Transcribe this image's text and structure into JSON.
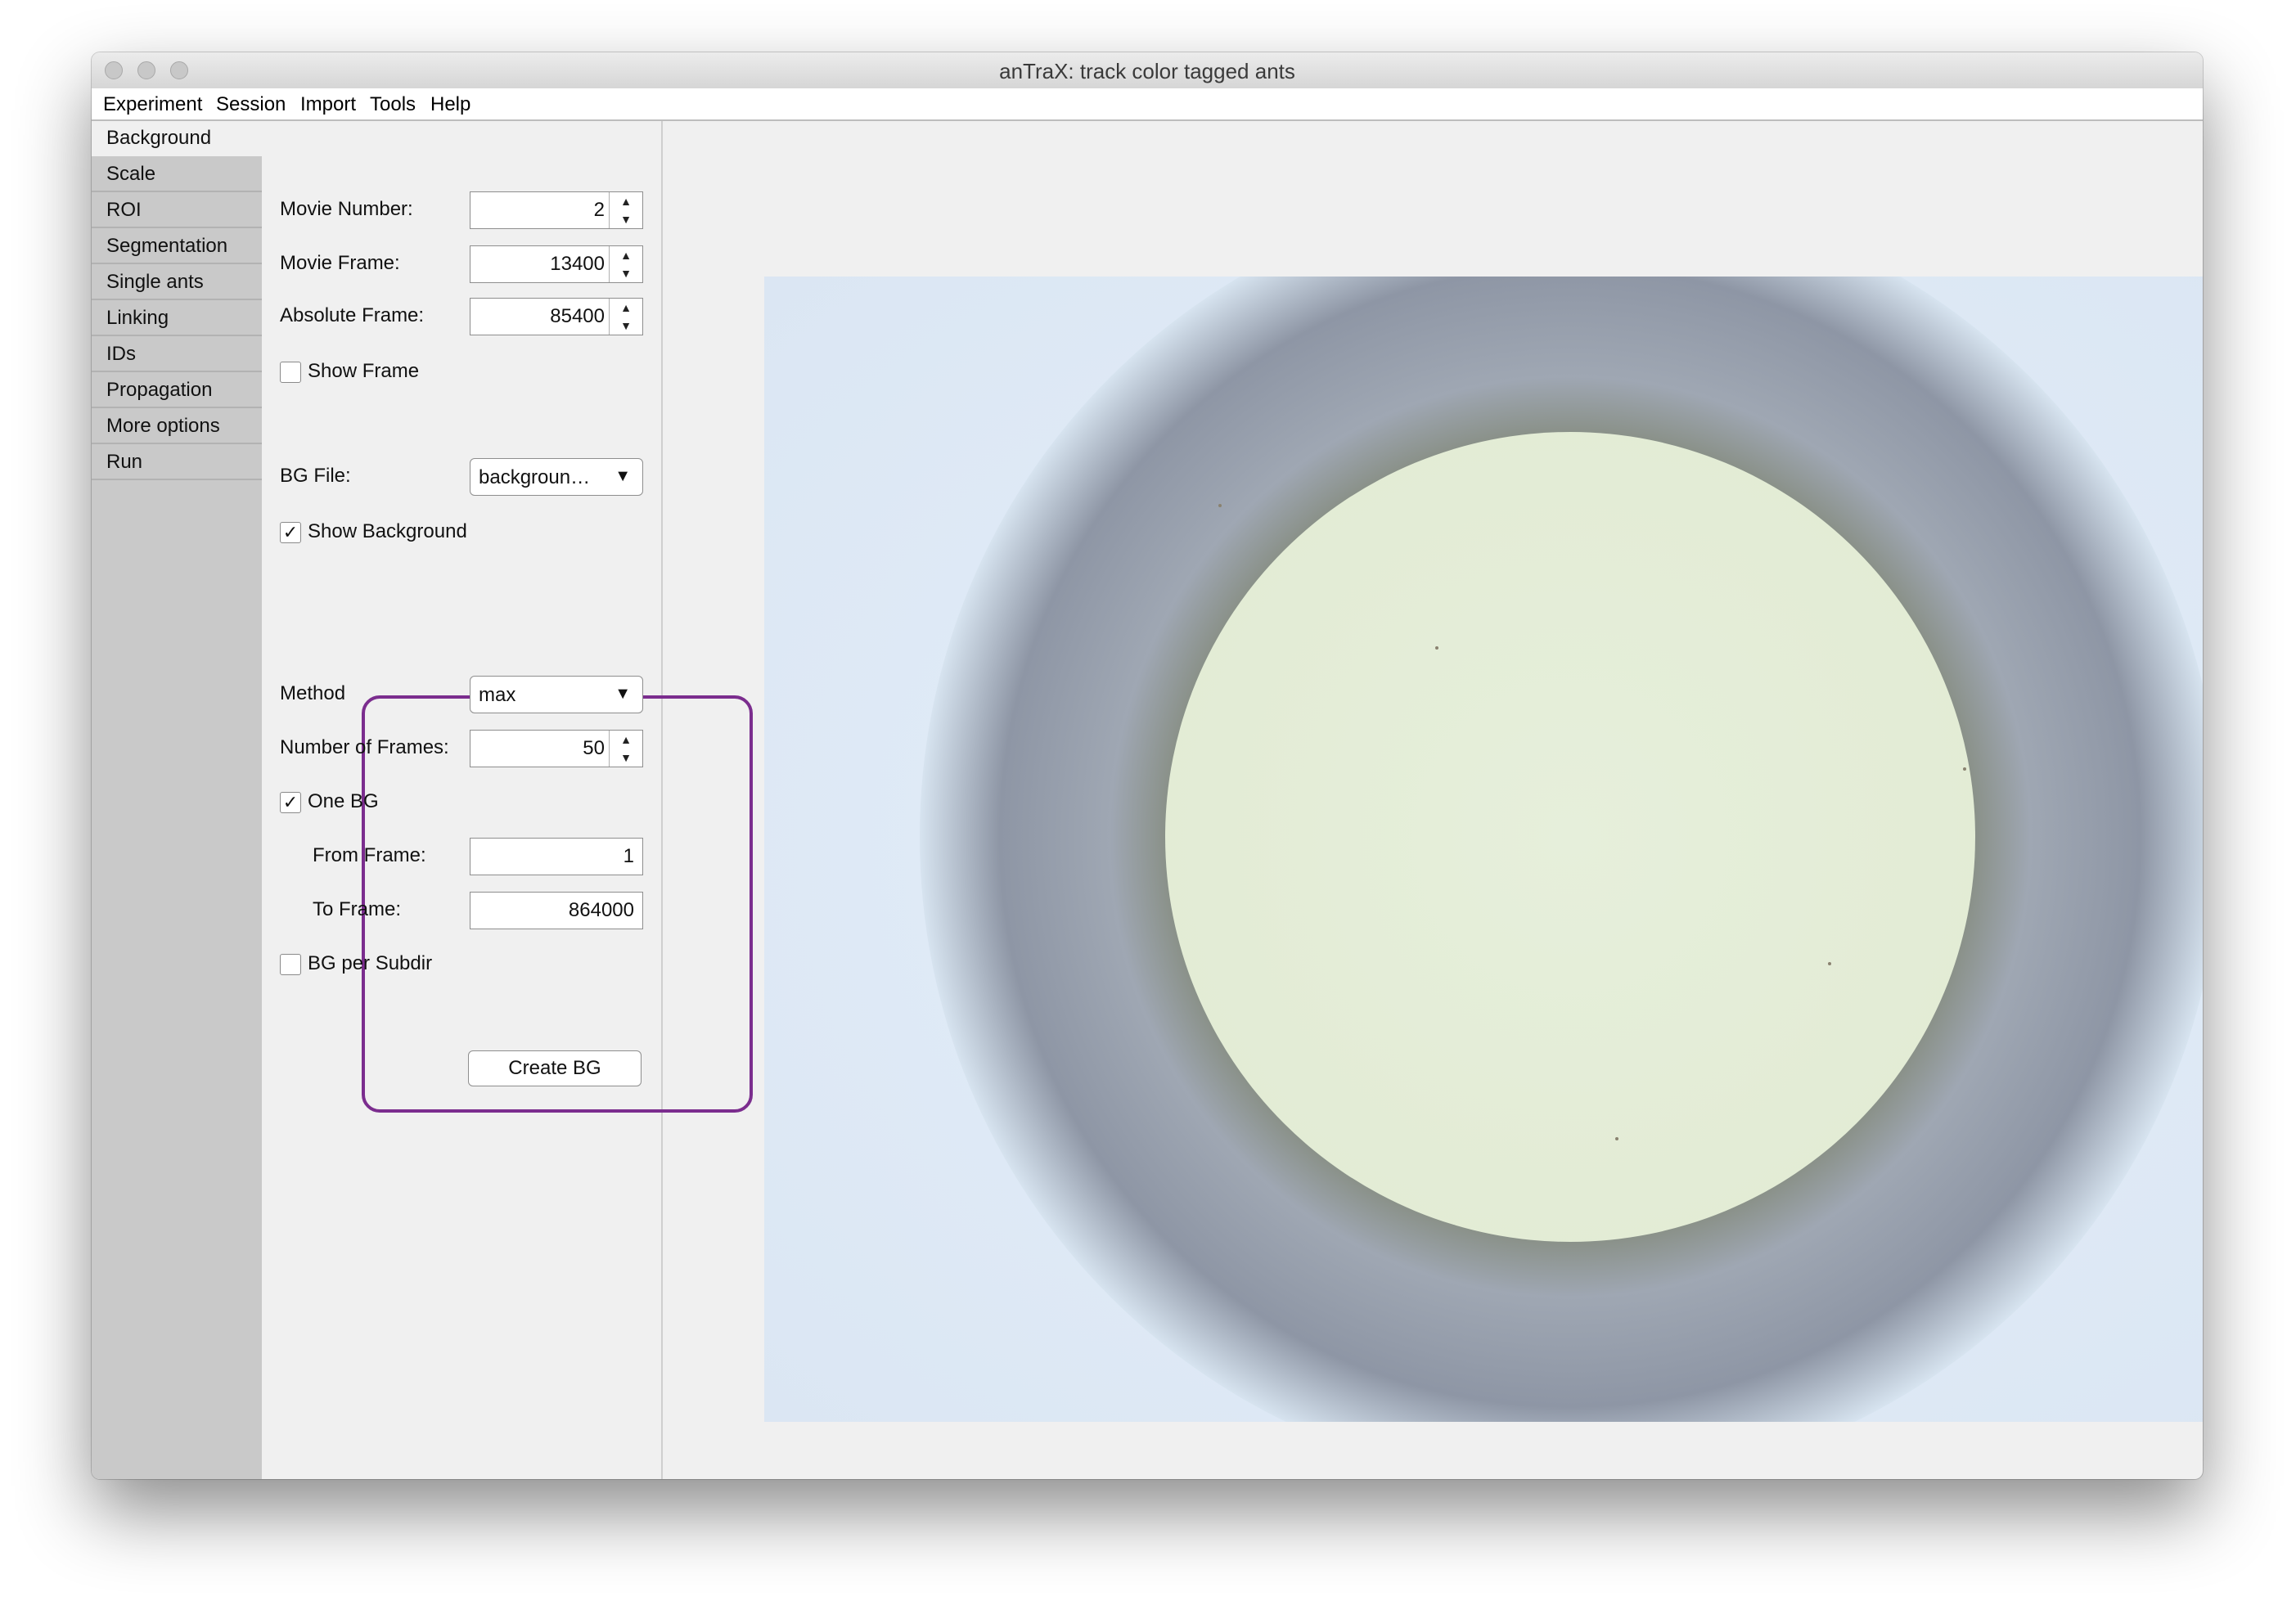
{
  "window": {
    "title": "anTraX: track color tagged ants"
  },
  "menu": [
    "Experiment",
    "Session",
    "Import",
    "Tools",
    "Help"
  ],
  "tabs": [
    "Background",
    "Scale",
    "ROI",
    "Segmentation",
    "Single ants",
    "Linking",
    "IDs",
    "Propagation",
    "More options",
    "Run"
  ],
  "active_tab": "Background",
  "form": {
    "movie_number": {
      "label": "Movie Number:",
      "value": "2"
    },
    "movie_frame": {
      "label": "Movie Frame:",
      "value": "13400"
    },
    "absolute_frame": {
      "label": "Absolute Frame:",
      "value": "85400"
    },
    "show_frame": {
      "label": "Show Frame",
      "checked": false
    },
    "bg_file": {
      "label": "BG File:",
      "value": "backgroun…"
    },
    "show_background": {
      "label": "Show Background",
      "checked": true
    },
    "method": {
      "label": "Method",
      "value": "max"
    },
    "number_of_frames": {
      "label": "Number of Frames:",
      "value": "50"
    },
    "one_bg": {
      "label": "One BG",
      "checked": true
    },
    "from_frame": {
      "label": "From Frame:",
      "value": "1"
    },
    "to_frame": {
      "label": "To Frame:",
      "value": "864000"
    },
    "bg_per_subdir": {
      "label": "BG per Subdir",
      "checked": false
    },
    "create_bg": {
      "label": "Create BG"
    }
  },
  "glyphs": {
    "check": "✓",
    "up": "▲",
    "down": "▼",
    "dropdown": "▼"
  },
  "colors": {
    "highlight": "#7b2d8e"
  }
}
